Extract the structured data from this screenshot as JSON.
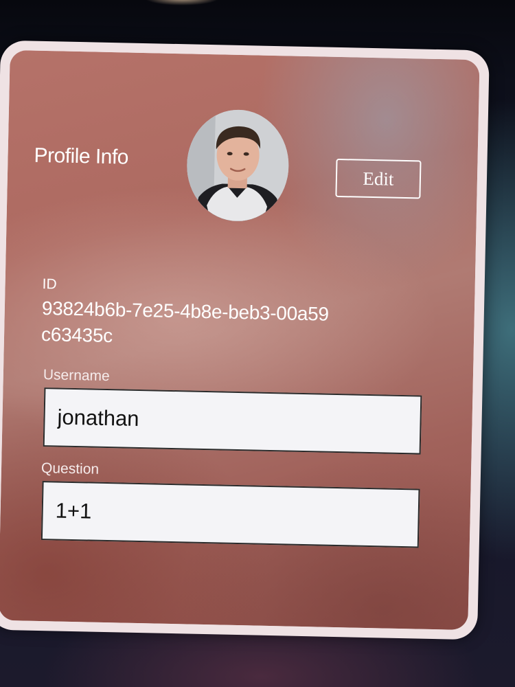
{
  "profile": {
    "title": "Profile Info",
    "edit_label": "Edit",
    "id_label": "ID",
    "id_value": "93824b6b-7e25-4b8e-beb3-00a59c63435c"
  },
  "fields": {
    "username_label": "Username",
    "username_value": "jonathan",
    "question_label": "Question",
    "question_value": "1+1"
  }
}
